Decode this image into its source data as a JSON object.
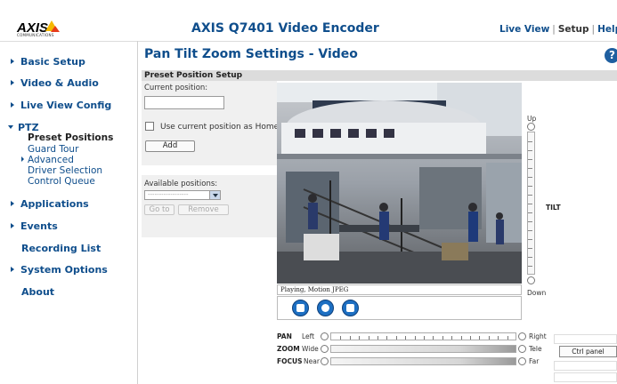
{
  "header": {
    "logo_text": "AXIS",
    "logo_sub": "COMMUNICATIONS",
    "title": "AXIS Q7401 Video Encoder",
    "links": {
      "live_view": "Live View",
      "setup": "Setup",
      "help": "Help",
      "sep": "|"
    }
  },
  "sidebar": {
    "items": {
      "basic_setup": "Basic Setup",
      "video_audio": "Video & Audio",
      "live_view_config": "Live View Config",
      "ptz": "PTZ",
      "applications": "Applications",
      "events": "Events",
      "recording_list": "Recording List",
      "system_options": "System Options",
      "about": "About"
    },
    "ptz_sub": {
      "preset_positions": "Preset Positions",
      "guard_tour": "Guard Tour",
      "advanced": "Advanced",
      "driver_selection": "Driver Selection",
      "control_queue": "Control Queue"
    }
  },
  "page": {
    "title": "Pan Tilt Zoom Settings - Video",
    "help_symbol": "?",
    "section": "Preset Position Setup"
  },
  "form": {
    "current_position_label": "Current position:",
    "current_position_value": "",
    "use_home_label": "Use current position as Home",
    "use_home_checked": false,
    "add_label": "Add",
    "available_positions_label": "Available positions:",
    "available_positions_selected": "------------------",
    "goto_label": "Go to",
    "remove_label": "Remove"
  },
  "video": {
    "status": "Playing, Motion JPEG"
  },
  "tilt": {
    "up": "Up",
    "down": "Down",
    "name": "TILT"
  },
  "controls": {
    "pan": {
      "name": "PAN",
      "left": "Left",
      "right": "Right"
    },
    "zoom": {
      "name": "ZOOM",
      "left": "Wide",
      "right": "Tele"
    },
    "focus": {
      "name": "FOCUS",
      "left": "Near",
      "right": "Far"
    },
    "ctrl_panel": "Ctrl panel"
  }
}
